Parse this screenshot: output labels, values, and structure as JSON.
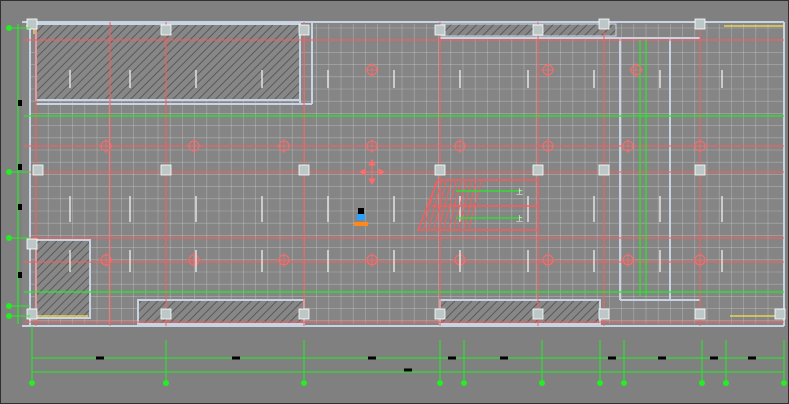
{
  "drawing": {
    "stair_direction_label_upper": "上",
    "stair_direction_label_lower": "上"
  },
  "colors": {
    "background": "#808080",
    "grid": "#d0d0d0",
    "wall": "#c8d4e4",
    "red_line": "#ff5a5a",
    "green_line": "#22ee22",
    "yellow_line": "#ffe04a",
    "column_fill": "#bcc8c8",
    "hatch": "#5a5a5a"
  },
  "icons": {
    "light_fixture": "circle-cross-icon",
    "ucs_marker": "ucs-axis-icon",
    "cursor": "crosshair-cursor-icon"
  }
}
